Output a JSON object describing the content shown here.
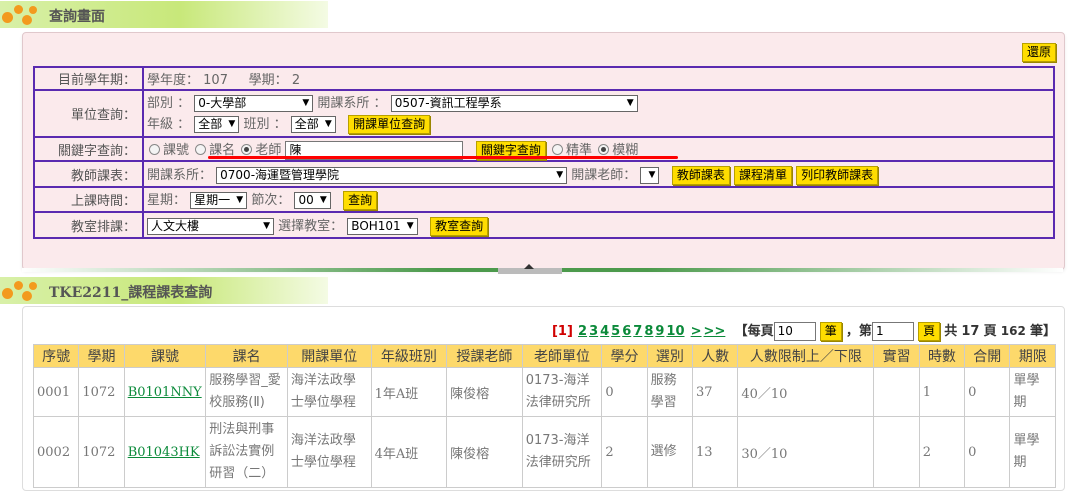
{
  "banners": {
    "query_title": "查詢畫面",
    "result_title": "TKE2211_課程課表查詢"
  },
  "panel": {
    "restore_label": "還原",
    "rows": {
      "year": {
        "label": "目前學年期：",
        "year_label": "學年度：",
        "year_value": "107",
        "term_label": "學期：",
        "term_value": "2"
      },
      "unit": {
        "label": "單位查詢：",
        "dept_label": "部別 ：",
        "dept_value": "0-大學部",
        "offer_label": "開課系所 ：",
        "offer_value": "0507-資訊工程學系",
        "grade_label": "年級 ：",
        "grade_value": "全部",
        "class_label": "班別 ：",
        "class_value": "全部",
        "button": "開課單位查詢"
      },
      "keyword": {
        "label": "關鍵字查詢：",
        "opt_code": "課號",
        "opt_name": "課名",
        "opt_teacher": "老師",
        "input_value": "陳",
        "button": "關鍵字查詢",
        "opt_exact": "精準",
        "opt_fuzzy": "模糊"
      },
      "teacher": {
        "label": "教師課表：",
        "offer_label": "開課系所：",
        "offer_value": "0700-海運暨管理學院",
        "teacher_label": "開課老師：",
        "teacher_value": "",
        "btn_schedule": "教師課表",
        "btn_list": "課程清單",
        "btn_print": "列印教師課表"
      },
      "time": {
        "label": "上課時間：",
        "week_label": "星期：",
        "week_value": "星期一",
        "period_label": "節次：",
        "period_value": "00",
        "button": "查詢"
      },
      "room": {
        "label": "教室排課：",
        "building_value": "人文大樓",
        "room_label": "選擇教室：",
        "room_value": "BOH101",
        "button": "教室查詢"
      }
    }
  },
  "pager": {
    "current": "[1]",
    "pages": [
      "2",
      "3",
      "4",
      "5",
      "6",
      "7",
      "8",
      "9",
      "10"
    ],
    "next": ">",
    "last": ">>",
    "per_page_label": "【每頁",
    "per_page_value": "10",
    "per_page_unit": "筆",
    "page_label": "，第",
    "page_value": "1",
    "page_unit": "頁",
    "total_text_a": "共",
    "total_pages": "17",
    "total_text_b": "頁",
    "total_records": "162",
    "total_text_c": "筆】"
  },
  "table": {
    "headers": [
      "序號",
      "學期",
      "課號",
      "課名",
      "開課單位",
      "年級班別",
      "授課老師",
      "老師單位",
      "學分",
      "選別",
      "人數",
      "人數限制上／下限",
      "實習",
      "時數",
      "合開",
      "期限"
    ],
    "rows": [
      {
        "seq": "0001",
        "term": "1072",
        "code": "B0101NNY",
        "name": "服務學習_愛校服務(Ⅱ)",
        "unit": "海洋法政學士學位學程",
        "grade": "1年A班",
        "teacher": "陳俊榕",
        "teacher_unit": "0173-海洋法律研究所",
        "credit": "0",
        "type": "服務學習",
        "count": "37",
        "limit": "40／10",
        "practice": "",
        "hours": "1",
        "joint": "0",
        "period": "單學期"
      },
      {
        "seq": "0002",
        "term": "1072",
        "code": "B01043HK",
        "name": "刑法與刑事訴訟法實例研習（二）",
        "unit": "海洋法政學士學位學程",
        "grade": "4年A班",
        "teacher": "陳俊榕",
        "teacher_unit": "0173-海洋法律研究所",
        "credit": "2",
        "type": "選修",
        "count": "13",
        "limit": "30／10",
        "practice": "",
        "hours": "2",
        "joint": "0",
        "period": "單學期"
      }
    ]
  },
  "colors": {
    "banner_green": "#c8e87a",
    "panel_bg": "#fbeaec",
    "table_border": "#5a2ab0",
    "button_yellow": "#ffdd00",
    "header_yellow": "#fdd96b",
    "link_green": "#0b8a3a",
    "highlight_red": "#ff0000"
  },
  "icons": {
    "banner_logo": "orange-dots-logo-icon",
    "dropdown": "triangle-down-icon"
  }
}
